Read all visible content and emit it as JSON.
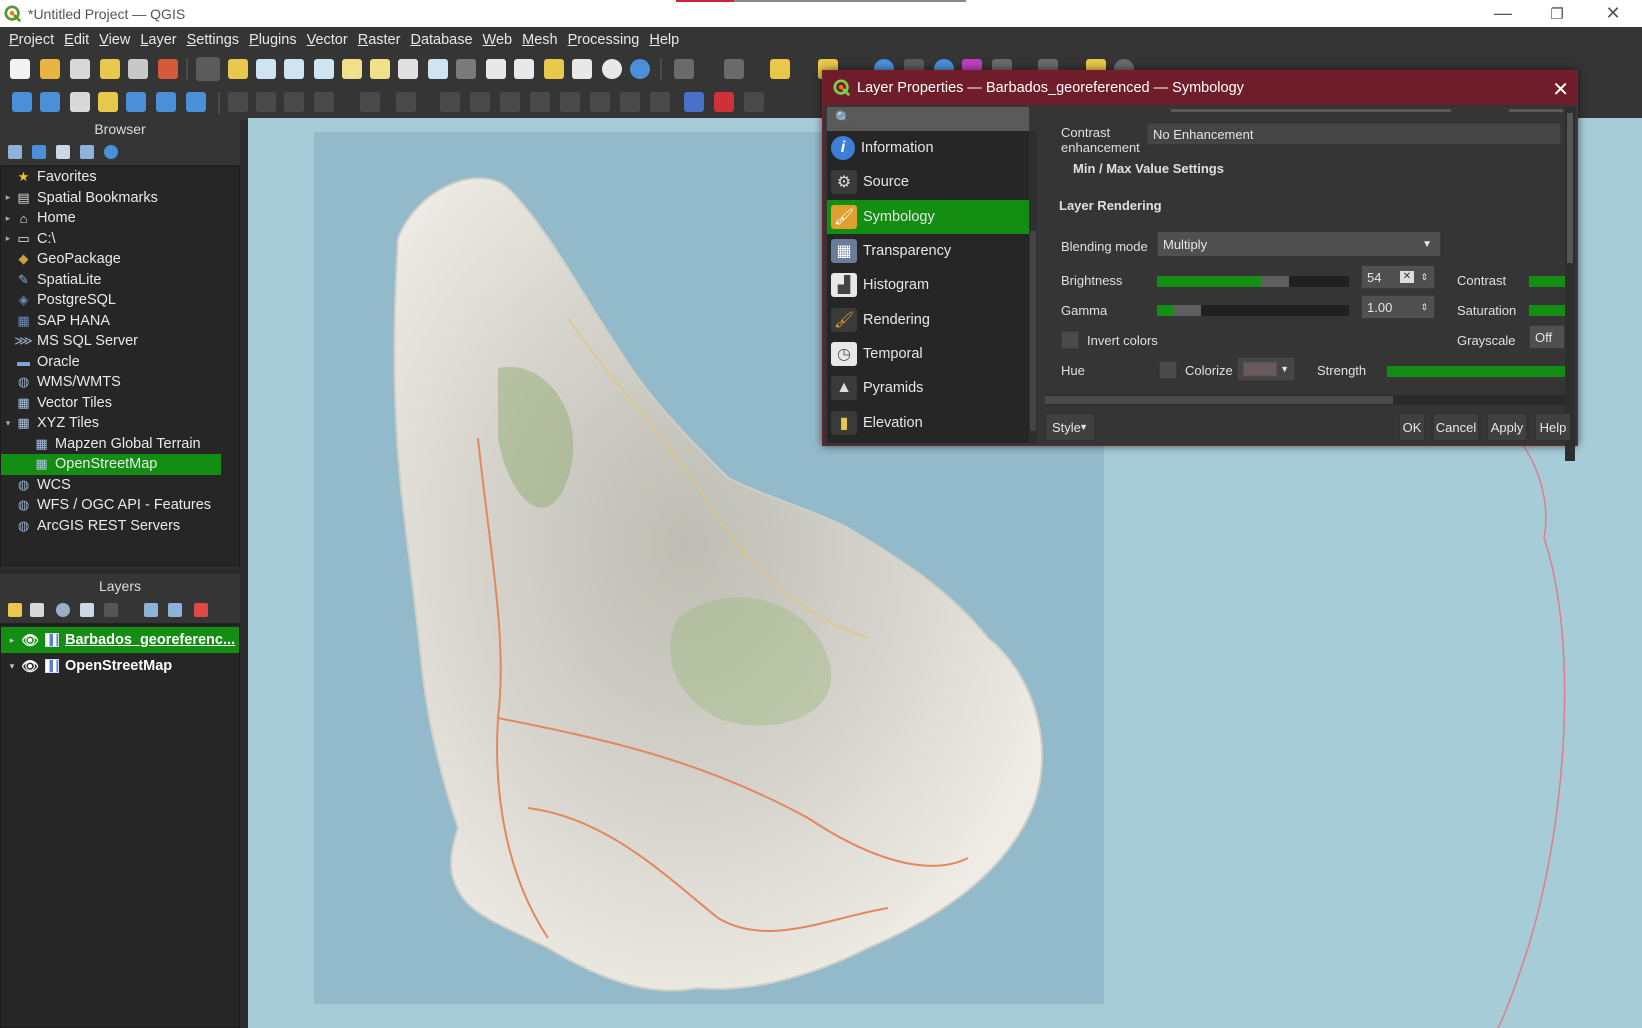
{
  "window": {
    "title": "*Untitled Project — QGIS",
    "minimize_glyph": "—",
    "restore_glyph": "❐",
    "close_glyph": "✕"
  },
  "menubar": [
    "Project",
    "Edit",
    "View",
    "Layer",
    "Settings",
    "Plugins",
    "Vector",
    "Raster",
    "Database",
    "Web",
    "Mesh",
    "Processing",
    "Help"
  ],
  "browser": {
    "title": "Browser",
    "items": [
      {
        "label": "Favorites",
        "icon": "star-icon",
        "arrow": ""
      },
      {
        "label": "Spatial Bookmarks",
        "icon": "bookmark-icon",
        "arrow": "▸"
      },
      {
        "label": "Home",
        "icon": "home-icon",
        "arrow": "▸"
      },
      {
        "label": "C:\\",
        "icon": "folder-icon",
        "arrow": "▸"
      },
      {
        "label": "GeoPackage",
        "icon": "geopackage-icon",
        "arrow": ""
      },
      {
        "label": "SpatiaLite",
        "icon": "spatialite-icon",
        "arrow": ""
      },
      {
        "label": "PostgreSQL",
        "icon": "postgresql-icon",
        "arrow": ""
      },
      {
        "label": "SAP HANA",
        "icon": "sap-hana-icon",
        "arrow": ""
      },
      {
        "label": "MS SQL Server",
        "icon": "mssql-icon",
        "arrow": ""
      },
      {
        "label": "Oracle",
        "icon": "oracle-icon",
        "arrow": ""
      },
      {
        "label": "WMS/WMTS",
        "icon": "globe-icon",
        "arrow": ""
      },
      {
        "label": "Vector Tiles",
        "icon": "grid-icon",
        "arrow": ""
      },
      {
        "label": "XYZ Tiles",
        "icon": "grid-icon",
        "arrow": "▾"
      },
      {
        "label": "Mapzen Global Terrain",
        "icon": "grid-icon",
        "arrow": "",
        "indent": true
      },
      {
        "label": "OpenStreetMap",
        "icon": "grid-icon",
        "arrow": "",
        "indent": true,
        "selected": true
      },
      {
        "label": "WCS",
        "icon": "globe-icon",
        "arrow": ""
      },
      {
        "label": "WFS / OGC API - Features",
        "icon": "globe-icon",
        "arrow": ""
      },
      {
        "label": "ArcGIS REST Servers",
        "icon": "arcgis-icon",
        "arrow": ""
      }
    ]
  },
  "layers": {
    "title": "Layers",
    "items": [
      {
        "label": "Barbados_georeferenc...",
        "selected": true
      },
      {
        "label": "OpenStreetMap",
        "selected": false
      }
    ]
  },
  "dialog": {
    "title": "Layer Properties — Barbados_georeferenced — Symbology",
    "close_glyph": "✕",
    "sidebar": [
      {
        "label": "Information",
        "icon": "info-icon"
      },
      {
        "label": "Source",
        "icon": "source-icon"
      },
      {
        "label": "Symbology",
        "icon": "symbology-brush-icon",
        "active": true
      },
      {
        "label": "Transparency",
        "icon": "transparency-icon"
      },
      {
        "label": "Histogram",
        "icon": "histogram-icon"
      },
      {
        "label": "Rendering",
        "icon": "rendering-brush-icon"
      },
      {
        "label": "Temporal",
        "icon": "clock-icon"
      },
      {
        "label": "Pyramids",
        "icon": "pyramid-icon"
      },
      {
        "label": "Elevation",
        "icon": "elevation-icon"
      }
    ],
    "contrast_label": "Contrast enhancement",
    "contrast_value": "No Enhancement",
    "minmax_label": "Min / Max Value Settings",
    "layer_rendering_label": "Layer Rendering",
    "blending_label": "Blending mode",
    "blending_value": "Multiply",
    "brightness_label": "Brightness",
    "brightness_value": "54",
    "brightness_fraction": 0.54,
    "contrast2_label": "Contrast",
    "gamma_label": "Gamma",
    "gamma_value": "1.00",
    "saturation_label": "Saturation",
    "invert_label": "Invert colors",
    "grayscale_label": "Grayscale",
    "grayscale_value": "Off",
    "hue_label": "Hue",
    "colorize_label": "Colorize",
    "strength_label": "Strength",
    "buttons": {
      "style": "Style",
      "ok": "OK",
      "cancel": "Cancel",
      "apply": "Apply",
      "help": "Help"
    }
  },
  "colors": {
    "accent_green": "#138e13",
    "dialog_title": "#6f1d2a",
    "sea": "#a6ccd8",
    "map_frame": "#92bacb"
  }
}
